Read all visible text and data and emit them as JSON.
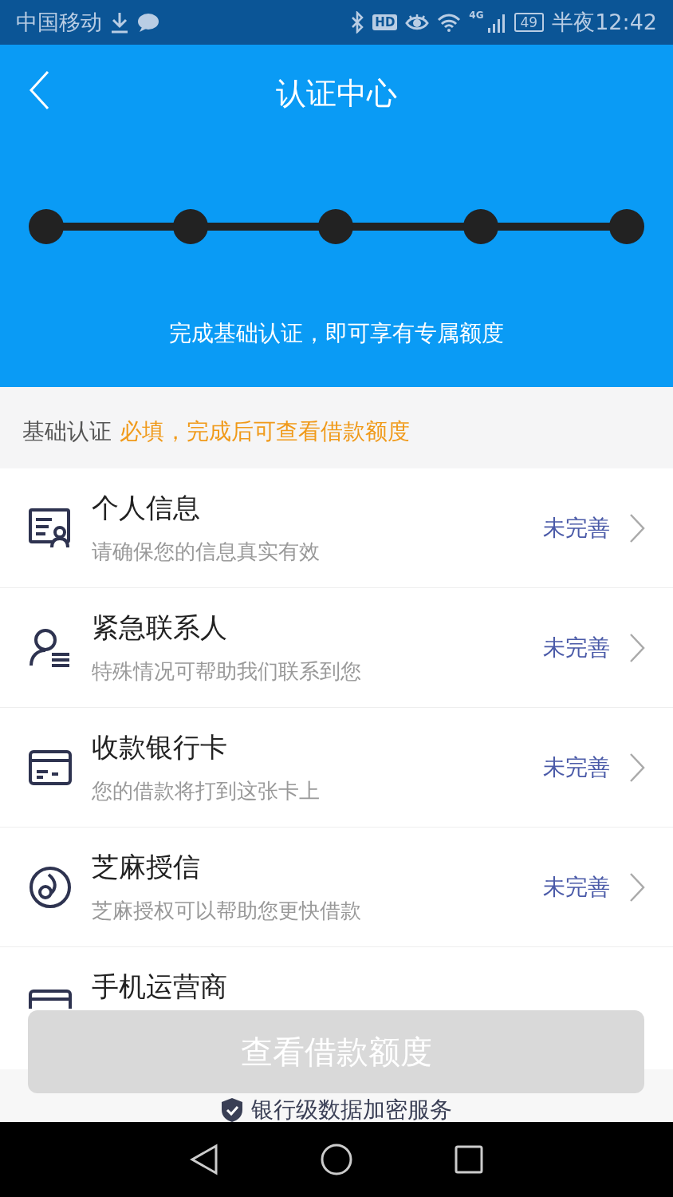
{
  "status_bar": {
    "carrier": "中国移动",
    "hd": "HD",
    "network": "4G",
    "battery": "49",
    "time": "半夜12:42"
  },
  "header": {
    "title": "认证中心",
    "subtitle": "完成基础认证，即可享有专属额度"
  },
  "section": {
    "title": "基础认证",
    "note": "必填，完成后可查看借款额度"
  },
  "items": [
    {
      "kind": "profile",
      "title": "个人信息",
      "subtitle": "请确保您的信息真实有效",
      "status": "未完善"
    },
    {
      "kind": "contact",
      "title": "紧急联系人",
      "subtitle": "特殊情况可帮助我们联系到您",
      "status": "未完善"
    },
    {
      "kind": "card",
      "title": "收款银行卡",
      "subtitle": "您的借款将打到这张卡上",
      "status": "未完善"
    },
    {
      "kind": "sesame",
      "title": "芝麻授信",
      "subtitle": "芝麻授权可以帮助您更快借款",
      "status": "未完善"
    },
    {
      "kind": "phone",
      "title": "手机运营商"
    }
  ],
  "button": {
    "label": "查看借款额度",
    "disabled": true
  },
  "security_note": "银行级数据加密服务"
}
